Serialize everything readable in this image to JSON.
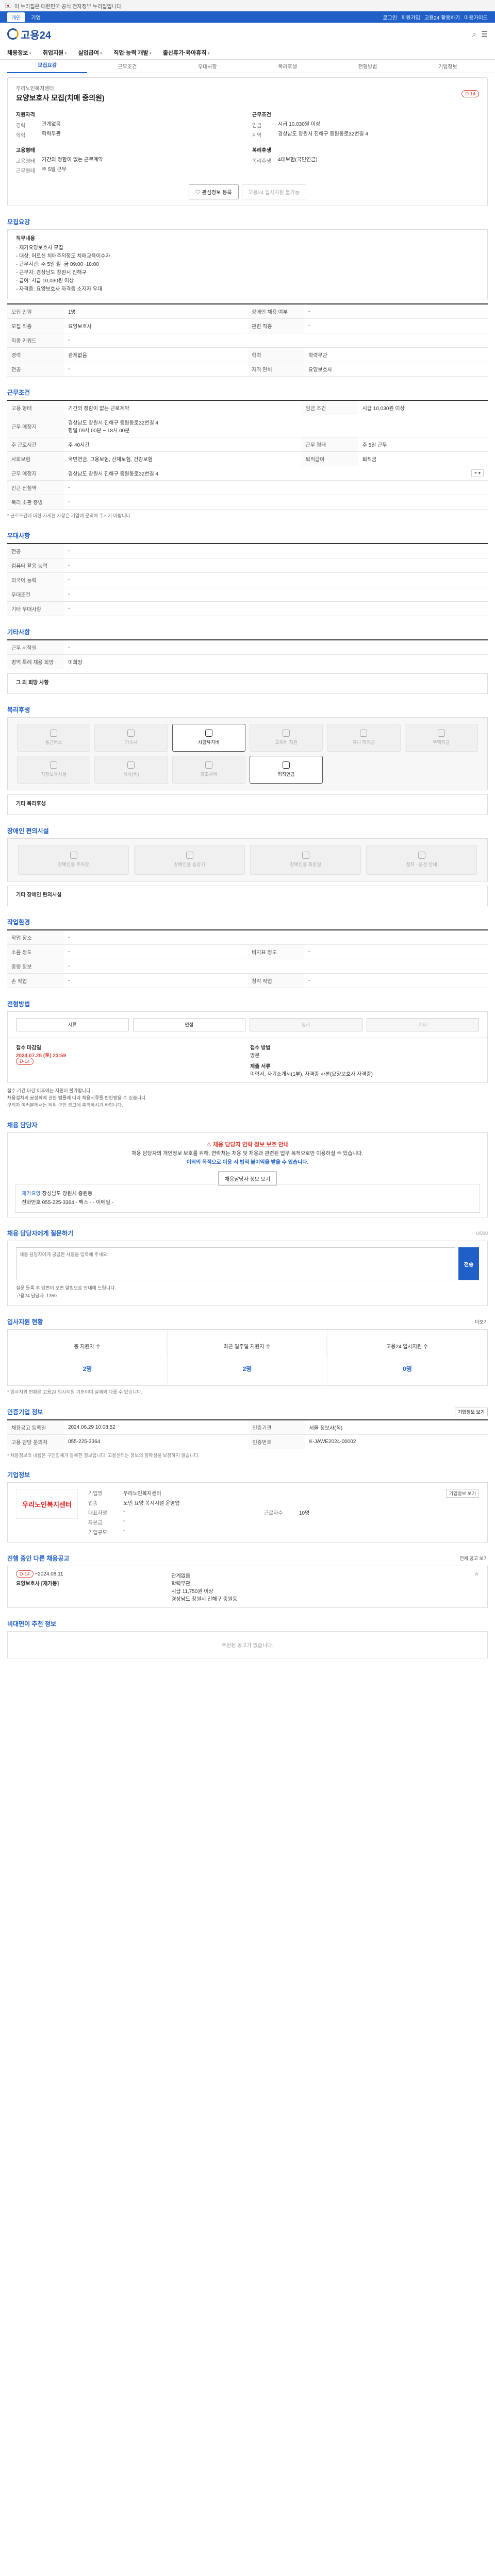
{
  "gov_bar": {
    "text": "이 누리집은 대한민국 공식 전자정부 누리집입니다."
  },
  "util": {
    "tab_personal": "개인",
    "tab_company": "기업",
    "right_links": [
      "로그인",
      "회원가입",
      "고용24 활용하기",
      "이용가이드"
    ]
  },
  "brand": {
    "name": "고용24"
  },
  "gnb": {
    "items": [
      "채용정보",
      "취업지원",
      "실업급여",
      "직업·능력 개발",
      "출산휴가·육아휴직"
    ]
  },
  "sub_tabs": [
    "모집요강",
    "근무조건",
    "우대사항",
    "복리후생",
    "전형방법",
    "기업정보"
  ],
  "job": {
    "company": "우리노인복지센터",
    "title": "요양보호사 모집(치매 중의원)",
    "dday": "D-14",
    "summary": {
      "req_title": "지원자격",
      "career_label": "경력",
      "career": "관계없음",
      "edu_label": "학력",
      "edu": "학력무관",
      "cond_title": "근무조건",
      "wage_label": "임금",
      "wage": "시급 10,030원 이상",
      "region_label": "지역",
      "region": "경상남도 창원시 진해구 중원동로32번길 4",
      "type_title": "고용형태",
      "type_label": "고용형태",
      "type": "기간의 정함이 없는 근로계약",
      "hours_label": "근무형태",
      "hours": "주 5일 근무",
      "welfare_title": "복리후생",
      "welfare_label": "복리후생",
      "welfare": "4대보험(국민연금)"
    },
    "btn_scrap": "관심정보 등록",
    "btn_apply": "고용24 입사지원 불가능"
  },
  "recruit": {
    "section": "모집요강",
    "duty_label": "직무내용",
    "duty_text": "- 재가요양보호사 모집\n- 대상: 어르신 치매주의정도 치매교육이수자\n- 근무시간: 주 5일 월~금 09:00~18:00\n- 근무지: 경상남도 창원시 진해구\n- 급여: 시급 10,030원 이상\n- 자격증: 요양보호사 자격증 소지자 우대",
    "rows": [
      [
        "모집 인원",
        "1명",
        "장애인 채용 여부",
        "-"
      ],
      [
        "모집 직종",
        "요양보호사",
        "관련 직종",
        "-"
      ],
      [
        "직종 키워드",
        "-",
        "",
        ""
      ],
      [
        "경력",
        "관계없음",
        "학력",
        "학력무관"
      ],
      [
        "전공",
        "-",
        "자격 면허",
        "요양보호사"
      ]
    ]
  },
  "work": {
    "section": "근무조건",
    "rows": [
      [
        "고용 형태",
        "기간의 정함이 없는 근로계약",
        "임금 조건",
        "시급 10,030원 이상"
      ],
      [
        "근무 예정지",
        "경상남도 창원시 진해구 중원동로32번길 4",
        "",
        ""
      ],
      [
        "주 근로시간",
        "주 40시간",
        "근무 형태",
        "주 5일 근무"
      ],
      [
        "사회보험",
        "국민연금, 고용보험, 산재보험, 건강보험",
        "퇴직급여",
        "퇴직금"
      ],
      [
        "근무 예정지",
        "경상남도 창원시 진해구 중원동로32번길 4",
        "",
        ""
      ],
      [
        "인근 전철역",
        "-",
        "",
        ""
      ],
      [
        "복리 소관 증빙",
        "-",
        "",
        ""
      ]
    ],
    "hours_note": "평일 09시 00분 ~ 18시 00분",
    "note": "* 근로조건에 대한 자세한 사항은 기업에 문의해 주시기 바랍니다."
  },
  "prefer": {
    "section": "우대사항",
    "rows": [
      [
        "전공",
        "-"
      ],
      [
        "컴퓨터 활용 능력",
        "-"
      ],
      [
        "외국어 능력",
        "-"
      ],
      [
        "우대조건",
        "-"
      ],
      [
        "기타 우대사항",
        "-"
      ]
    ]
  },
  "etc": {
    "section": "기타사항",
    "rows": [
      [
        "근무 시작일",
        "-"
      ],
      [
        "병역 특례 채용 희망",
        "미희망"
      ]
    ],
    "extra_label": "그 외 희망 사항"
  },
  "benefit": {
    "section": "복리후생",
    "items": [
      {
        "label": "통근버스",
        "on": false
      },
      {
        "label": "기숙사",
        "on": false
      },
      {
        "label": "차량유지비",
        "on": true
      },
      {
        "label": "교육비 지원",
        "on": false
      },
      {
        "label": "자녀 학자금",
        "on": false
      },
      {
        "label": "주택자금",
        "on": false
      },
      {
        "label": "직장보육시설",
        "on": false
      },
      {
        "label": "식사(비)",
        "on": false
      },
      {
        "label": "경조사비",
        "on": false
      },
      {
        "label": "퇴직연금",
        "on": true
      }
    ],
    "other_label": "기타 복리후생"
  },
  "facility": {
    "section": "장애인 편의시설",
    "items": [
      "장애인용 주차장",
      "장애인용 승강기",
      "장애인용 화장실",
      "점자 · 음성 안내"
    ],
    "other_label": "기타 장애인 편의시설"
  },
  "workplace": {
    "section": "작업환경",
    "rows": [
      [
        "작업 장소",
        "-",
        "",
        ""
      ],
      [
        "소음 정도",
        "-",
        "비지표 정도",
        "-"
      ],
      [
        "중량 정보",
        "-",
        "",
        ""
      ],
      [
        "손 작업",
        "-",
        "청각 작업",
        "-"
      ]
    ]
  },
  "process": {
    "section": "전형방법",
    "steps": [
      {
        "label": "서류",
        "on": true
      },
      {
        "label": "면접",
        "on": true
      },
      {
        "label": "필기",
        "on": false
      },
      {
        "label": "기타",
        "on": false
      }
    ],
    "deadline_label": "접수 마감일",
    "deadline": "2024.07.28 (토) 23:59",
    "dday": "D-14",
    "method_label": "접수 방법",
    "method": "방문",
    "docs_label": "제출 서류",
    "docs": "이력서, 자기소개서(1부), 자격증 사본(요양보호사 자격증)",
    "bullets": [
      "접수 기간 마감 이후에는 지원이 불가합니다.",
      "채용절차의 공정화에 관한 법률에 따라 채용서류를 반환받을 수 있습니다.",
      "구직자 여러분께서는 허위 구인 광고에 주의하시기 바랍니다."
    ]
  },
  "contact": {
    "section": "채용 담당자",
    "alert_head": "채용 담당자 연락 정보 보호 안내",
    "alert_line1": "채용 담당자의 개인정보 보호를 위해, 연락처는 채용 및 채용과 관련된 업무 목적으로만 이용하실 수 있습니다.",
    "alert_line2": "이외의 목적으로 이용 시 법적 불이익을 받을 수 있습니다.",
    "show_button": "채용담당자 정보 보기",
    "mgr_class": "재가요양",
    "mgr_name": "장성남도 창원시 중원동",
    "mgr_phone_label": "전화번호",
    "mgr_phone": "055-225-3364",
    "mgr_fax_label": "팩스",
    "mgr_fax": "-",
    "mgr_email_label": "이메일",
    "mgr_email": "-"
  },
  "qa": {
    "section": "채용 담당자에게 질문하기",
    "counter": "0/500",
    "placeholder": "채용 담당자에게 궁금한 사항을 입력해 주세요.",
    "send": "전송",
    "bullets": [
      "질문 등록 후 답변이 오면 알림으로 안내해 드립니다.",
      "고용24 담당자: 1350"
    ]
  },
  "applicants": {
    "section": "입사지원 현황",
    "link": "더보기",
    "stats": [
      {
        "label": "총 지원자 수",
        "value": "2명"
      },
      {
        "label": "최근 일주일 지원자 수",
        "value": "2명"
      },
      {
        "label": "고용24 입사지원 수",
        "value": "0명"
      }
    ],
    "note": "* 입사지원 현황은 고용24 입사지원 기준이며 실제와 다를 수 있습니다."
  },
  "info": {
    "section": "인증기업 정보",
    "link": "기업정보 보기",
    "rows": [
      [
        "채용공고 등록일",
        "2024.06.29 10:08:52",
        "인증기관",
        "서울 정보사(적)"
      ],
      [
        "고용 담당 문의처",
        "055-225-3364",
        "인증번호",
        "K-JAWE2024-00002"
      ]
    ],
    "note": "* 채용정보의 내용은 구인업체가 등록한 정보입니다. 고용센터는 정보의 정확성을 보장하지 않습니다."
  },
  "company": {
    "section": "기업정보",
    "logo_text": "우리노인복지센터",
    "grid": [
      [
        "기업명",
        "우리노인복지센터",
        "",
        ""
      ],
      [
        "업종",
        "노인 요양 복지시설 운영업",
        "",
        ""
      ],
      [
        "대표자명",
        "-",
        "근로자수",
        "10명"
      ],
      [
        "자본금",
        "-",
        "",
        ""
      ],
      [
        "기업규모",
        "-",
        "",
        ""
      ]
    ],
    "button": "기업정보 보기"
  },
  "ongoing": {
    "section": "진행 중인 다른 채용공고",
    "link": "전체 공고 보기",
    "dday": "D-14",
    "date": "~2024.08.11",
    "title": "요양보호사 [재가동]",
    "career": "관계없음",
    "edu": "학력무관",
    "wage": "시급 11,750원 이상",
    "region": "경상남도 창원시 진해구 중원동"
  },
  "recommend": {
    "section": "비대면이 추천 정보",
    "empty": "추천된 공고가 없습니다."
  }
}
